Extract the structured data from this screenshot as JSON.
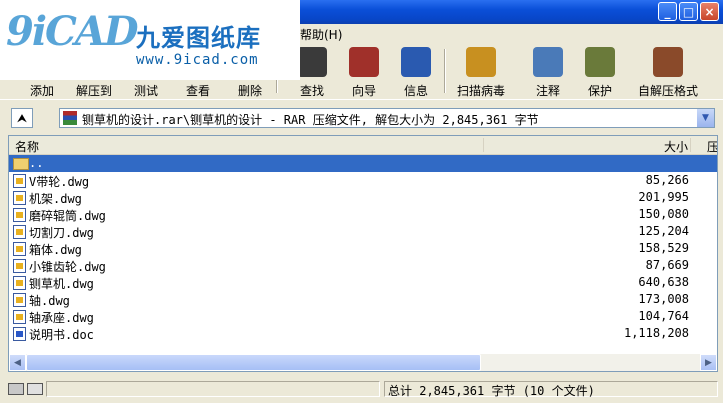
{
  "window": {
    "buttons": [
      "_",
      "□",
      "×"
    ]
  },
  "logo": {
    "mark": "9iCAD",
    "name": "九爱图纸库",
    "url": "www.9icad.com"
  },
  "menu": {
    "help": "帮助(H)"
  },
  "toolbar": [
    {
      "label": "添加",
      "icon": "add-icon",
      "color": "#3a6fc8"
    },
    {
      "label": "解压到",
      "icon": "extract-icon",
      "color": "#2f7f3a"
    },
    {
      "label": "测试",
      "icon": "test-icon",
      "color": "#c83a3a"
    },
    {
      "label": "查看",
      "icon": "view-icon",
      "color": "#5a5aa8"
    },
    {
      "label": "删除",
      "icon": "delete-icon",
      "color": "#7a7a7a"
    },
    {
      "label": "查找",
      "icon": "find-icon",
      "color": "#3a3a3a"
    },
    {
      "label": "向导",
      "icon": "wizard-icon",
      "color": "#a0302a"
    },
    {
      "label": "信息",
      "icon": "info-icon",
      "color": "#2a5ab0"
    },
    {
      "label": "扫描病毒",
      "icon": "virus-scan-icon",
      "color": "#c89020"
    },
    {
      "label": "注释",
      "icon": "comment-icon",
      "color": "#4a7ab8"
    },
    {
      "label": "保护",
      "icon": "protect-icon",
      "color": "#6a7a3a"
    },
    {
      "label": "自解压格式",
      "icon": "sfx-icon",
      "color": "#8a4a2a"
    }
  ],
  "address": {
    "path": "铡草机的设计.rar\\铡草机的设计 - RAR 压缩文件, 解包大小为 2,845,361 字节"
  },
  "columns": {
    "name": "名称",
    "size": "大小",
    "packed": "压"
  },
  "files": [
    {
      "name": "..",
      "size": "",
      "type": "folder",
      "selected": true
    },
    {
      "name": "V带轮.dwg",
      "size": "85,266",
      "type": "dwg"
    },
    {
      "name": "机架.dwg",
      "size": "201,995",
      "type": "dwg"
    },
    {
      "name": "磨碎辊筒.dwg",
      "size": "150,080",
      "type": "dwg"
    },
    {
      "name": "切割刀.dwg",
      "size": "125,204",
      "type": "dwg"
    },
    {
      "name": "箱体.dwg",
      "size": "158,529",
      "type": "dwg"
    },
    {
      "name": "小锥齿轮.dwg",
      "size": "87,669",
      "type": "dwg"
    },
    {
      "name": "铡草机.dwg",
      "size": "640,638",
      "type": "dwg"
    },
    {
      "name": "轴.dwg",
      "size": "173,008",
      "type": "dwg"
    },
    {
      "name": "轴承座.dwg",
      "size": "104,764",
      "type": "dwg"
    },
    {
      "name": "说明书.doc",
      "size": "1,118,208",
      "type": "doc"
    }
  ],
  "status": {
    "total": "总计 2,845,361 字节 (10 个文件)"
  }
}
